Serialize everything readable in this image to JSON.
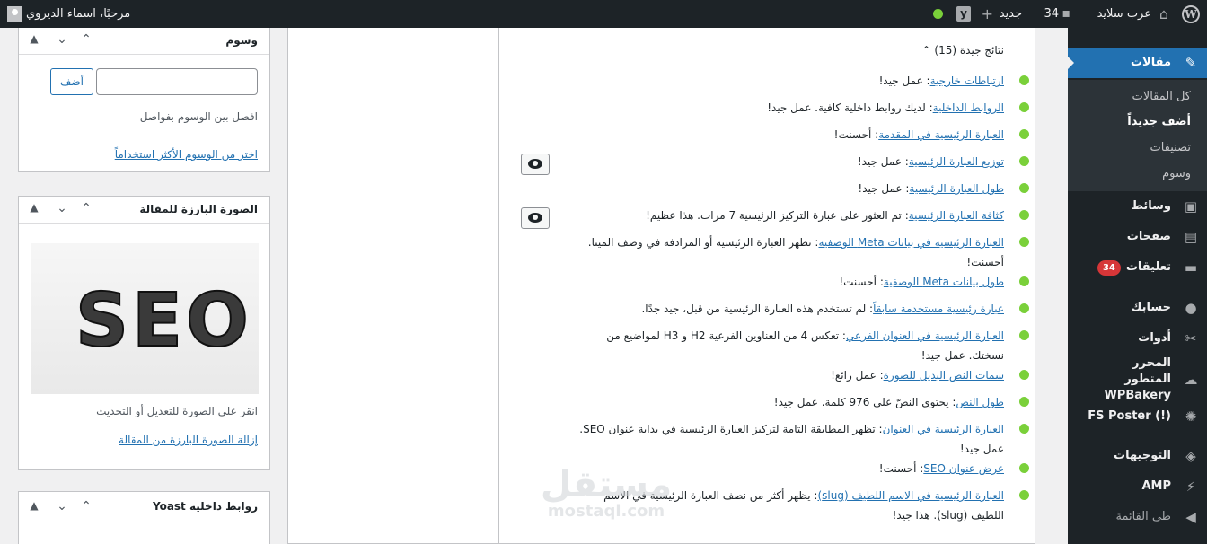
{
  "adminbar": {
    "site_name": "عرب سلايد",
    "comments_count": "34",
    "new_label": "جديد",
    "plus": "+",
    "yoast_letter": "y",
    "greeting": "مرحبًا، اسماء الديروي"
  },
  "menu": {
    "posts": "مقالات",
    "submenu": [
      "كل المقالات",
      "أضف جديداً",
      "تصنيفات",
      "وسوم"
    ],
    "media": "وسائط",
    "pages": "صفحات",
    "comments": "تعليقات",
    "comments_badge": "34",
    "profile": "حسابك",
    "tools": "أدوات",
    "wpbakery": "المحرر المتطور WPBakery",
    "fs_poster": "FS Poster (!)",
    "directions": "التوجيهات",
    "amp": "AMP",
    "collapse": "طي القائمة"
  },
  "tags_box": {
    "title": "وسوم",
    "add_button": "أضف",
    "help": "افصل بين الوسوم بفواصل",
    "choose_link": "اختر من الوسوم الأكثر استخداماً"
  },
  "featured_box": {
    "title": "الصورة البارزة للمقالة",
    "image_text": "SEO",
    "help": "انقر على الصورة للتعديل أو التحديث",
    "remove_link": "إزالة الصورة البارزة من المقالة"
  },
  "yoast_links_box": {
    "title": "Yoast روابط داخلية"
  },
  "seo_results": {
    "header": "نتائج جيدة (15)",
    "items": [
      {
        "link": "ارتباطات خارجية",
        "text": ": عمل جيد!",
        "eye": false
      },
      {
        "link": "الروابط الداخلية",
        "text": ": لديك روابط داخلية كافية. عمل جيد!",
        "eye": false
      },
      {
        "link": "العبارة الرئيسية في المقدمة",
        "text": ": أحسنت!",
        "eye": false
      },
      {
        "link": "توزيع العبارة الرئيسية",
        "text": ": عمل جيد!",
        "eye": true
      },
      {
        "link": "طول العبارة الرئيسية",
        "text": ": عمل جيد!",
        "eye": false
      },
      {
        "link": "كثافة العبارة الرئيسية",
        "text": ": تم العثور على عبارة التركيز الرئيسية 7 مرات. هذا عظيم!",
        "eye": true
      },
      {
        "link": "العبارة الرئيسية في بيانات Meta الوصفية",
        "text": ": تظهر العبارة الرئيسية أو المرادفة في وصف الميتا. أحسنت!",
        "eye": false
      },
      {
        "link": "طول بيانات Meta الوصفية",
        "text": ": أحسنت!",
        "eye": false
      },
      {
        "link": "عبارة رئيسية مستخدمة سابقاً",
        "text": ": لم تستخدم هذه العبارة الرئيسية من قبل، جيد جدًا.",
        "eye": false
      },
      {
        "link": "العبارة الرئيسية في العنوان الفرعي",
        "text": ": تعكس 4 من العناوين الفرعية H2 و H3 لمواضيع من نسختك. عمل جيد!",
        "eye": false
      },
      {
        "link": "سمات النص البديل للصورة",
        "text": ": عمل رائع!",
        "eye": false
      },
      {
        "link": "طول النص",
        "text": ": يحتوي النصّ على 976 كلمة. عمل جيد!",
        "eye": false
      },
      {
        "link": "العبارة الرئيسية في العنوان",
        "text": ": تظهر المطابقة التامة لتركيز العبارة الرئيسية في بداية عنوان SEO. عمل جيد!",
        "eye": false
      },
      {
        "link": "عرض عنوان SEO",
        "text": ": أحسنت!",
        "eye": false
      },
      {
        "link": "العبارة الرئيسية في الاسم اللطيف (slug)",
        "text": ": يظهر أكثر من نصف العبارة الرئيسية في الاسم اللطيف (slug). هذا جيد!",
        "eye": false
      }
    ]
  },
  "watermark": {
    "arabic": "مستقل",
    "latin": "mostaql.com"
  },
  "colors": {
    "admin_bar": "#1d2327",
    "accent": "#2271b1",
    "good": "#7ad03a",
    "badge": "#d63638"
  }
}
